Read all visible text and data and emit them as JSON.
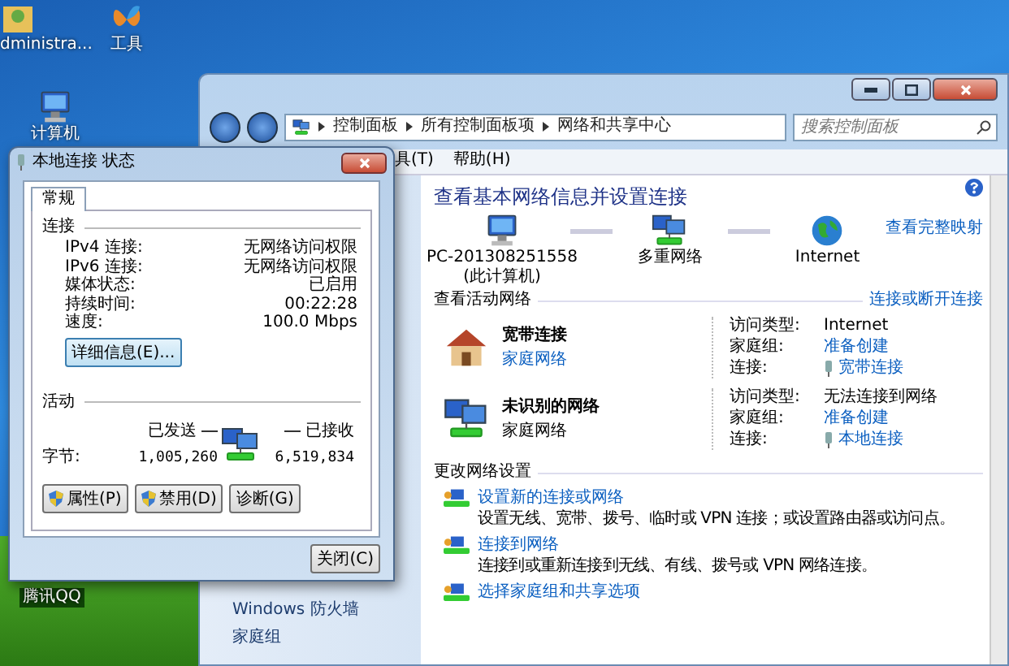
{
  "desktop_icons": [
    {
      "label": "dministra...",
      "kind": "user"
    },
    {
      "label": "工具",
      "kind": "butterfly"
    },
    {
      "label": "计算机",
      "kind": "computer"
    },
    {
      "label": "腾讯QQ",
      "kind": "none"
    }
  ],
  "explorer": {
    "address": [
      "控制面板",
      "所有控制面板项",
      "网络和共享中心"
    ],
    "search": {
      "placeholder": "搜索控制面板"
    },
    "menu": [
      "具(T)",
      "帮助(H)"
    ],
    "nav_items": [
      "Windows 防火墙",
      "家庭组"
    ],
    "heading": "查看基本网络信息并设置连接",
    "map_link": "查看完整映射",
    "map_nodes": [
      {
        "label": "PC-201308251558",
        "sublabel": "(此计算机)",
        "kind": "computer"
      },
      {
        "label": "多重网络",
        "kind": "network"
      },
      {
        "label": "Internet",
        "kind": "globe"
      }
    ],
    "active_title": "查看活动网络",
    "active_link": "连接或断开连接",
    "networks": [
      {
        "name": "宽带连接",
        "type": "家庭网络",
        "type_is_link": true,
        "kind": "house",
        "rows": [
          {
            "label": "访问类型:",
            "value": "Internet",
            "kind": "text"
          },
          {
            "label": "家庭组:",
            "value": "准备创建",
            "kind": "link"
          },
          {
            "label": "连接:",
            "value": "宽带连接",
            "kind": "connection"
          }
        ]
      },
      {
        "name": "未识别的网络",
        "type": "家庭网络",
        "type_is_link": false,
        "kind": "network",
        "rows": [
          {
            "label": "访问类型:",
            "value": "无法连接到网络",
            "kind": "text"
          },
          {
            "label": "家庭组:",
            "value": "准备创建",
            "kind": "link"
          },
          {
            "label": "连接:",
            "value": "本地连接",
            "kind": "connection"
          }
        ]
      }
    ],
    "settings_title": "更改网络设置",
    "tasks": [
      {
        "title": "设置新的连接或网络",
        "desc": "设置无线、宽带、拨号、临时或 VPN 连接；或设置路由器或访问点。"
      },
      {
        "title": "连接到网络",
        "desc": "连接到或重新连接到无线、有线、拨号或 VPN 网络连接。"
      },
      {
        "title": "选择家庭组和共享选项"
      }
    ]
  },
  "dialog": {
    "title": "本地连接 状态",
    "tabs": [
      {
        "label": "常规",
        "selected": true
      }
    ],
    "connection_title": "连接",
    "rows": [
      {
        "label": "IPv4 连接:",
        "value": "无网络访问权限"
      },
      {
        "label": "IPv6 连接:",
        "value": "无网络访问权限"
      },
      {
        "label": "媒体状态:",
        "value": "已启用"
      },
      {
        "label": "持续时间:",
        "value": "00:22:28"
      },
      {
        "label": "速度:",
        "value": "100.0 Mbps"
      }
    ],
    "details_button": "详细信息(E)...",
    "activity_title": "活动",
    "sent_label": "已发送",
    "received_label": "已接收",
    "bytes_label": "字节:",
    "bytes_sent": "1,005,260",
    "bytes_received": "6,519,834",
    "buttons": [
      {
        "label": "属性(P)",
        "kind": "shield"
      },
      {
        "label": "禁用(D)",
        "kind": "shield"
      },
      {
        "label": "诊断(G)",
        "kind": "plain"
      }
    ],
    "close_button": "关闭(C)"
  }
}
